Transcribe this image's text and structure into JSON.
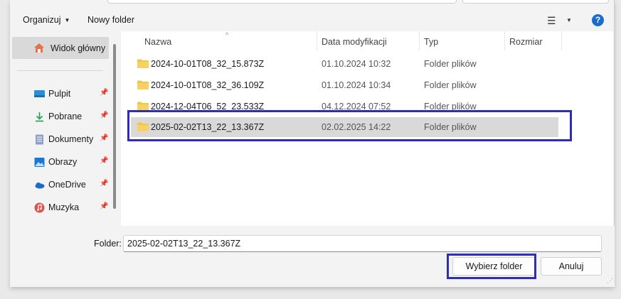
{
  "toolbar": {
    "organize_label": "Organizuj",
    "new_folder_label": "Nowy folder",
    "view_icon": "list-view-icon",
    "help_label": "?"
  },
  "nav": {
    "home_label": "Widok główny",
    "items": [
      {
        "label": "Pulpit",
        "icon": "desktop-icon",
        "color": "#2a8fd6"
      },
      {
        "label": "Pobrane",
        "icon": "download-icon",
        "color": "#1f9d55"
      },
      {
        "label": "Dokumenty",
        "icon": "documents-icon",
        "color": "#6b7fa8"
      },
      {
        "label": "Obrazy",
        "icon": "pictures-icon",
        "color": "#1c77d2"
      },
      {
        "label": "OneDrive",
        "icon": "onedrive-icon",
        "color": "#1c6ac9"
      },
      {
        "label": "Muzyka",
        "icon": "music-icon",
        "color": "#d9534f"
      }
    ]
  },
  "columns": {
    "name": "Nazwa",
    "date": "Data modyfikacji",
    "type": "Typ",
    "size": "Rozmiar"
  },
  "files": [
    {
      "name": "2024-10-01T08_32_15.873Z",
      "date": "01.10.2024 10:32",
      "type": "Folder plików",
      "selected": false
    },
    {
      "name": "2024-10-01T08_32_36.109Z",
      "date": "01.10.2024 10:34",
      "type": "Folder plików",
      "selected": false
    },
    {
      "name": "2024-12-04T06_52_23.533Z",
      "date": "04.12.2024 07:52",
      "type": "Folder plików",
      "selected": false
    },
    {
      "name": "2025-02-02T13_22_13.367Z",
      "date": "02.02.2025 14:22",
      "type": "Folder plików",
      "selected": true
    }
  ],
  "footer": {
    "folder_label": "Folder:",
    "folder_value": "2025-02-02T13_22_13.367Z",
    "select_button": "Wybierz folder",
    "cancel_button": "Anuluj"
  },
  "colors": {
    "highlight": "#2d2db5",
    "folder": "#f4c542",
    "help": "#1c6ac9"
  }
}
